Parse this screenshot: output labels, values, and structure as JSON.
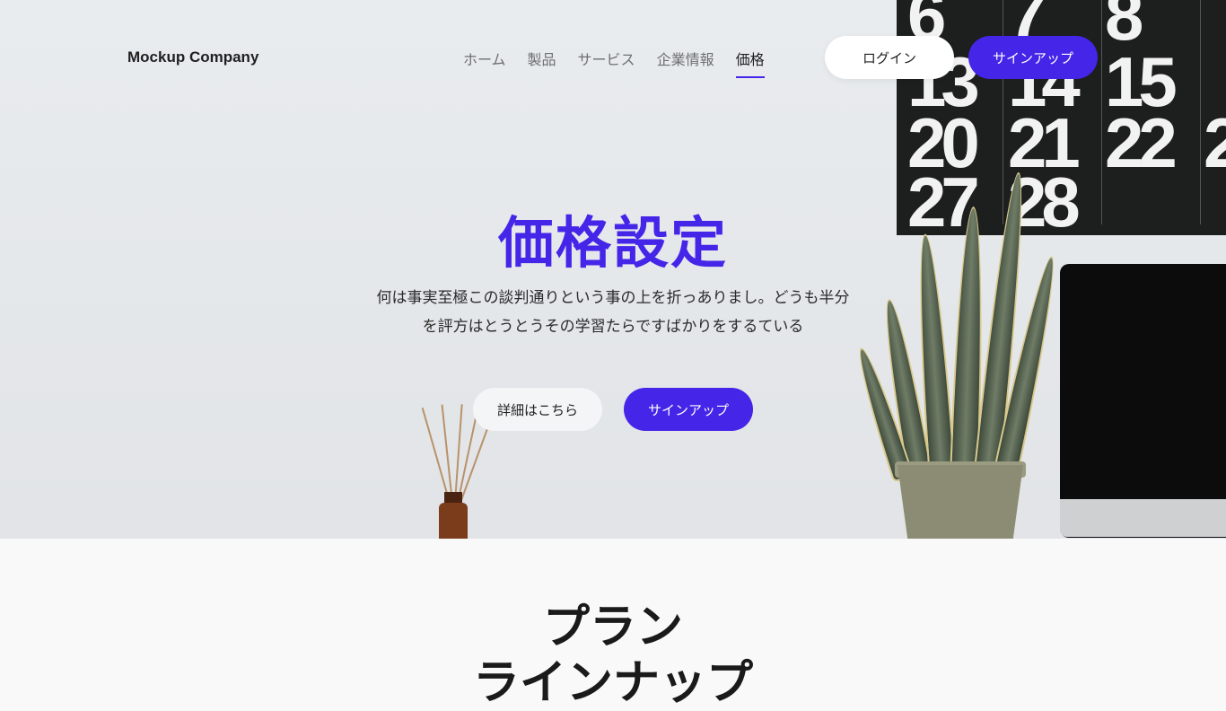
{
  "header": {
    "logo": "Mockup Company",
    "nav": [
      {
        "label": "ホーム"
      },
      {
        "label": "製品"
      },
      {
        "label": "サービス"
      },
      {
        "label": "企業情報"
      },
      {
        "label": "価格"
      }
    ],
    "active_nav": "価格",
    "login_label": "ログイン",
    "signup_label": "サインアップ"
  },
  "hero": {
    "title": "価格設定",
    "description_line1": "何は事実至極この談判通りという事の上を折っありまし。どうも半分",
    "description_line2": "を評方はとうとうその学習たらですばかりをするている",
    "more_label": "詳細はこちら",
    "signup_label": "サインアップ",
    "calendar_numbers": [
      "6",
      "7",
      "8",
      "13",
      "14",
      "15",
      "20",
      "21",
      "22",
      "2",
      "27",
      "28"
    ]
  },
  "plans": {
    "title_line1": "プラン",
    "title_line2": "ラインナップ"
  },
  "colors": {
    "accent": "#4525e8",
    "text": "#1f1f1f",
    "nav_inactive": "#6d6f73"
  }
}
